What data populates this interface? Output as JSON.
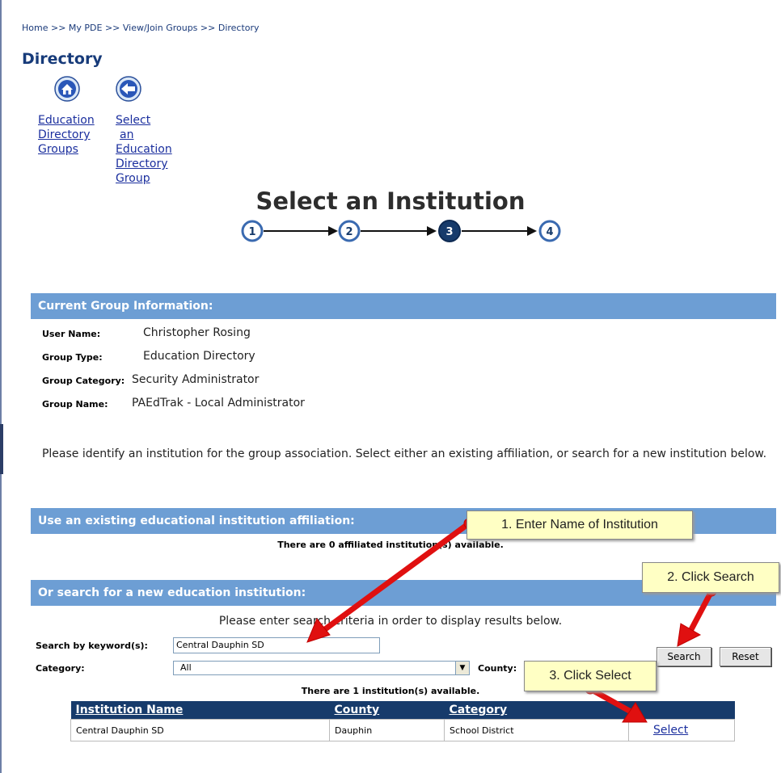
{
  "breadcrumb": "Home >> My PDE >> View/Join Groups >> Directory",
  "page_title": "Directory",
  "nav": {
    "home_link": [
      "Education",
      "Directory",
      "Groups"
    ],
    "back_link": [
      "Select",
      "an",
      "Education",
      "Directory",
      "Group"
    ]
  },
  "wizard": {
    "title": "Select an Institution",
    "steps": [
      "1",
      "2",
      "3",
      "4"
    ],
    "active_step": 3
  },
  "group_info": {
    "header": "Current Group Information:",
    "rows": [
      {
        "label": "User Name:",
        "value": "Christopher Rosing"
      },
      {
        "label": "Group Type:",
        "value": "Education Directory"
      },
      {
        "label": "Group Category:",
        "value": "Security Administrator"
      },
      {
        "label": "Group Name:",
        "value": "PAEdTrak - Local Administrator"
      }
    ]
  },
  "instructions": "Please identify an institution for the group association. Select either an existing affiliation, or search for a new institution below.",
  "existing": {
    "header": "Use an existing educational institution affiliation:",
    "note": "There are 0 affiliated institution(s) available."
  },
  "search": {
    "header": "Or search for a new education institution:",
    "prompt": "Please enter search criteria in order to display results below.",
    "keyword_label": "Search by keyword(s):",
    "keyword_value": "Central Dauphin SD",
    "category_label": "Category:",
    "category_value": "All",
    "county_label": "County:",
    "search_button": "Search",
    "reset_button": "Reset",
    "results_note": "There are 1 institution(s) available."
  },
  "results": {
    "columns": [
      "Institution Name",
      "County",
      "Category",
      ""
    ],
    "rows": [
      {
        "name": "Central Dauphin SD",
        "county": "Dauphin",
        "category": "School District",
        "action": "Select"
      }
    ]
  },
  "callouts": {
    "c1": "1. Enter Name of Institution",
    "c2": "2. Click Search",
    "c3": "3. Click Select"
  },
  "colors": {
    "section_bar": "#6d9ed4",
    "table_header": "#173b6b",
    "callout_bg": "#ffffc4",
    "arrow": "#e01010"
  }
}
